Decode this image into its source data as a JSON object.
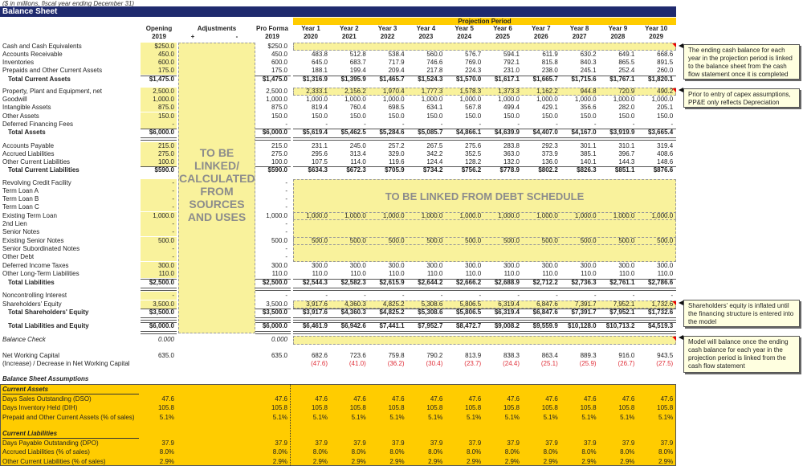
{
  "header": {
    "units_note": "($ in millions, fiscal year ending December 31)",
    "title": "Balance Sheet",
    "projection_label": "Projection Period",
    "opening_label": "Opening",
    "opening_year": "2019",
    "adjustments_label": "Adjustments",
    "plus": "+",
    "minus": "-",
    "proforma_label": "Pro Forma",
    "proforma_year": "2019",
    "years": [
      {
        "label": "Year 1",
        "year": "2020"
      },
      {
        "label": "Year 2",
        "year": "2021"
      },
      {
        "label": "Year 3",
        "year": "2022"
      },
      {
        "label": "Year 4",
        "year": "2023"
      },
      {
        "label": "Year 5",
        "year": "2024"
      },
      {
        "label": "Year 6",
        "year": "2025"
      },
      {
        "label": "Year 7",
        "year": "2026"
      },
      {
        "label": "Year 8",
        "year": "2027"
      },
      {
        "label": "Year 9",
        "year": "2028"
      },
      {
        "label": "Year 10",
        "year": "2029"
      }
    ]
  },
  "adjustments_text": [
    "TO BE",
    "LINKED/",
    "CALCULATED",
    "FROM",
    "SOURCES",
    "AND USES"
  ],
  "debt_schedule_text": "TO BE LINKED FROM DEBT SCHEDULE",
  "rows": [
    {
      "label": "Cash and Cash Equivalents",
      "opening": "$250.0",
      "proforma": "$250.0",
      "years": [
        "",
        "",
        "",
        "",
        "",
        "",
        "",
        "",
        "",
        ""
      ]
    },
    {
      "label": "Accounts Receivable",
      "opening": "450.0",
      "proforma": "450.0",
      "years": [
        "483.8",
        "512.8",
        "538.4",
        "560.0",
        "576.7",
        "594.1",
        "611.9",
        "630.2",
        "649.1",
        "668.6"
      ]
    },
    {
      "label": "Inventories",
      "opening": "600.0",
      "proforma": "600.0",
      "years": [
        "645.0",
        "683.7",
        "717.9",
        "746.6",
        "769.0",
        "792.1",
        "815.8",
        "840.3",
        "865.5",
        "891.5"
      ]
    },
    {
      "label": "Prepaids and Other Current Assets",
      "opening": "175.0",
      "proforma": "175.0",
      "years": [
        "188.1",
        "199.4",
        "209.4",
        "217.8",
        "224.3",
        "231.0",
        "238.0",
        "245.1",
        "252.4",
        "260.0"
      ]
    },
    {
      "label": "Total Current Assets",
      "type": "total",
      "opening": "$1,475.0",
      "proforma": "$1,475.0",
      "years": [
        "$1,316.9",
        "$1,395.9",
        "$1,465.7",
        "$1,524.3",
        "$1,570.0",
        "$1,617.1",
        "$1,665.7",
        "$1,715.6",
        "$1,767.1",
        "$1,820.1"
      ]
    },
    {
      "label": "Property, Plant and Equipment, net",
      "opening": "2,500.0",
      "proforma": "2,500.0",
      "years": [
        "2,333.1",
        "2,156.2",
        "1,970.4",
        "1,777.3",
        "1,578.3",
        "1,373.3",
        "1,162.2",
        "944.8",
        "720.9",
        "490.2"
      ]
    },
    {
      "label": "Goodwill",
      "opening": "1,000.0",
      "proforma": "1,000.0",
      "years": [
        "1,000.0",
        "1,000.0",
        "1,000.0",
        "1,000.0",
        "1,000.0",
        "1,000.0",
        "1,000.0",
        "1,000.0",
        "1,000.0",
        "1,000.0"
      ]
    },
    {
      "label": "Intangible Assets",
      "opening": "875.0",
      "proforma": "875.0",
      "years": [
        "819.4",
        "760.4",
        "698.5",
        "634.1",
        "567.8",
        "499.4",
        "429.1",
        "356.6",
        "282.0",
        "205.1"
      ]
    },
    {
      "label": "Other Assets",
      "opening": "150.0",
      "proforma": "150.0",
      "years": [
        "150.0",
        "150.0",
        "150.0",
        "150.0",
        "150.0",
        "150.0",
        "150.0",
        "150.0",
        "150.0",
        "150.0"
      ]
    },
    {
      "label": "Deferred Financing Fees",
      "opening": "-",
      "proforma": "-",
      "years": [
        "-",
        "-",
        "-",
        "-",
        "-",
        "-",
        "-",
        "-",
        "-",
        "-"
      ]
    },
    {
      "label": "Total Assets",
      "type": "total",
      "opening": "$6,000.0",
      "proforma": "$6,000.0",
      "years": [
        "$5,619.4",
        "$5,462.5",
        "$5,284.6",
        "$5,085.7",
        "$4,866.1",
        "$4,639.9",
        "$4,407.0",
        "$4,167.0",
        "$3,919.9",
        "$3,665.4"
      ]
    },
    {
      "label": "Accounts Payable",
      "opening": "215.0",
      "proforma": "215.0",
      "years": [
        "231.1",
        "245.0",
        "257.2",
        "267.5",
        "275.6",
        "283.8",
        "292.3",
        "301.1",
        "310.1",
        "319.4"
      ]
    },
    {
      "label": "Accrued Liabilities",
      "opening": "275.0",
      "proforma": "275.0",
      "years": [
        "295.6",
        "313.4",
        "329.0",
        "342.2",
        "352.5",
        "363.0",
        "373.9",
        "385.1",
        "396.7",
        "408.6"
      ]
    },
    {
      "label": "Other Current Liabilities",
      "opening": "100.0",
      "proforma": "100.0",
      "years": [
        "107.5",
        "114.0",
        "119.6",
        "124.4",
        "128.2",
        "132.0",
        "136.0",
        "140.1",
        "144.3",
        "148.6"
      ]
    },
    {
      "label": "Total Current Liabilities",
      "type": "total",
      "opening": "$590.0",
      "proforma": "$590.0",
      "years": [
        "$634.3",
        "$672.3",
        "$705.9",
        "$734.2",
        "$756.2",
        "$778.9",
        "$802.2",
        "$826.3",
        "$851.1",
        "$876.6"
      ]
    },
    {
      "label": "Revolving Credit Facility",
      "opening": "-",
      "proforma": "-",
      "years": [
        "",
        "",
        "",
        "",
        "",
        "",
        "",
        "",
        "",
        ""
      ]
    },
    {
      "label": "Term Loan A",
      "opening": "-",
      "proforma": "-",
      "years": [
        "",
        "",
        "",
        "",
        "",
        "",
        "",
        "",
        "",
        ""
      ]
    },
    {
      "label": "Term Loan B",
      "opening": "-",
      "proforma": "-",
      "years": [
        "",
        "",
        "",
        "",
        "",
        "",
        "",
        "",
        "",
        ""
      ]
    },
    {
      "label": "Term Loan C",
      "opening": "-",
      "proforma": "-",
      "years": [
        "",
        "",
        "",
        "",
        "",
        "",
        "",
        "",
        "",
        ""
      ]
    },
    {
      "label": "Existing Term Loan",
      "opening": "1,000.0",
      "proforma": "1,000.0",
      "years": [
        "1,000.0",
        "1,000.0",
        "1,000.0",
        "1,000.0",
        "1,000.0",
        "1,000.0",
        "1,000.0",
        "1,000.0",
        "1,000.0",
        "1,000.0"
      ]
    },
    {
      "label": "2nd Lien",
      "opening": "-",
      "proforma": "-",
      "years": [
        "",
        "",
        "",
        "",
        "",
        "",
        "",
        "",
        "",
        ""
      ]
    },
    {
      "label": "Senior Notes",
      "opening": "-",
      "proforma": "-",
      "years": [
        "",
        "",
        "",
        "",
        "",
        "",
        "",
        "",
        "",
        ""
      ]
    },
    {
      "label": "Existing Senior Notes",
      "opening": "500.0",
      "proforma": "500.0",
      "years": [
        "500.0",
        "500.0",
        "500.0",
        "500.0",
        "500.0",
        "500.0",
        "500.0",
        "500.0",
        "500.0",
        "500.0"
      ]
    },
    {
      "label": "Senior Subordinated Notes",
      "opening": "-",
      "proforma": "-",
      "years": [
        "",
        "",
        "",
        "",
        "",
        "",
        "",
        "",
        "",
        ""
      ]
    },
    {
      "label": "Other Debt",
      "opening": "-",
      "proforma": "-",
      "years": [
        "",
        "",
        "",
        "",
        "",
        "",
        "",
        "",
        "",
        ""
      ]
    },
    {
      "label": "Deferred Income Taxes",
      "opening": "300.0",
      "proforma": "300.0",
      "years": [
        "300.0",
        "300.0",
        "300.0",
        "300.0",
        "300.0",
        "300.0",
        "300.0",
        "300.0",
        "300.0",
        "300.0"
      ]
    },
    {
      "label": "Other Long-Term Liabilities",
      "opening": "110.0",
      "proforma": "110.0",
      "years": [
        "110.0",
        "110.0",
        "110.0",
        "110.0",
        "110.0",
        "110.0",
        "110.0",
        "110.0",
        "110.0",
        "110.0"
      ]
    },
    {
      "label": "Total Liabilities",
      "type": "total",
      "opening": "$2,500.0",
      "proforma": "$2,500.0",
      "years": [
        "$2,544.3",
        "$2,582.3",
        "$2,615.9",
        "$2,644.2",
        "$2,666.2",
        "$2,688.9",
        "$2,712.2",
        "$2,736.3",
        "$2,761.1",
        "$2,786.6"
      ]
    },
    {
      "label": "Noncontrolling Interest",
      "opening": "-",
      "proforma": "-",
      "years": [
        "-",
        "-",
        "-",
        "-",
        "-",
        "-",
        "-",
        "-",
        "-",
        "-"
      ]
    },
    {
      "label": "Shareholders' Equity",
      "opening": "3,500.0",
      "proforma": "3,500.0",
      "years": [
        "3,917.6",
        "4,360.3",
        "4,825.2",
        "5,308.6",
        "5,806.5",
        "6,319.4",
        "6,847.6",
        "7,391.7",
        "7,952.1",
        "1,732.6"
      ]
    },
    {
      "label": "Total Shareholders' Equity",
      "type": "total",
      "opening": "$3,500.0",
      "proforma": "$3,500.0",
      "years": [
        "$3,917.6",
        "$4,360.3",
        "$4,825.2",
        "$5,308.6",
        "$5,806.5",
        "$6,319.4",
        "$6,847.6",
        "$7,391.7",
        "$7,952.1",
        "$1,732.6"
      ]
    },
    {
      "label": "Total Liabilities and Equity",
      "type": "total",
      "opening": "$6,000.0",
      "proforma": "$6,000.0",
      "years": [
        "$6,461.9",
        "$6,942.6",
        "$7,441.1",
        "$7,952.7",
        "$8,472.7",
        "$9,008.2",
        "$9,559.9",
        "$10,128.0",
        "$10,713.2",
        "$4,519.3"
      ]
    },
    {
      "label": "Balance Check",
      "type": "italic",
      "opening": "0.000",
      "proforma": "0.000",
      "years": [
        "",
        "",
        "",
        "",
        "",
        "",
        "",
        "",
        "",
        ""
      ]
    },
    {
      "label": "Net Working Capital",
      "opening": "635.0",
      "proforma": "635.0",
      "years": [
        "682.6",
        "723.6",
        "759.8",
        "790.2",
        "813.9",
        "838.3",
        "863.4",
        "889.3",
        "916.0",
        "943.5"
      ]
    },
    {
      "label": "(Increase) / Decrease in Net Working Capital",
      "type": "red",
      "opening": "",
      "proforma": "",
      "years": [
        "(47.6)",
        "(41.0)",
        "(36.2)",
        "(30.4)",
        "(23.7)",
        "(24.4)",
        "(25.1)",
        "(25.9)",
        "(26.7)",
        "(27.5)"
      ]
    }
  ],
  "assumptions": {
    "title": "Balance Sheet Assumptions",
    "sections": [
      {
        "title": "Current Assets",
        "rows": [
          {
            "label": "Days Sales Outstanding (DSO)",
            "opening": "47.6",
            "proforma": "47.6",
            "years": [
              "47.6",
              "47.6",
              "47.6",
              "47.6",
              "47.6",
              "47.6",
              "47.6",
              "47.6",
              "47.6",
              "47.6"
            ]
          },
          {
            "label": "Days Inventory Held (DIH)",
            "opening": "105.8",
            "proforma": "105.8",
            "years": [
              "105.8",
              "105.8",
              "105.8",
              "105.8",
              "105.8",
              "105.8",
              "105.8",
              "105.8",
              "105.8",
              "105.8"
            ]
          },
          {
            "label": "Prepaid and Other Current Assets (% of sales)",
            "opening": "5.1%",
            "proforma": "5.1%",
            "years": [
              "5.1%",
              "5.1%",
              "5.1%",
              "5.1%",
              "5.1%",
              "5.1%",
              "5.1%",
              "5.1%",
              "5.1%",
              "5.1%"
            ]
          }
        ]
      },
      {
        "title": "Current Liabilities",
        "rows": [
          {
            "label": "Days Payable Outstanding (DPO)",
            "opening": "37.9",
            "proforma": "37.9",
            "years": [
              "37.9",
              "37.9",
              "37.9",
              "37.9",
              "37.9",
              "37.9",
              "37.9",
              "37.9",
              "37.9",
              "37.9"
            ]
          },
          {
            "label": "Accrued Liabilities (% of sales)",
            "opening": "8.0%",
            "proforma": "8.0%",
            "years": [
              "8.0%",
              "8.0%",
              "8.0%",
              "8.0%",
              "8.0%",
              "8.0%",
              "8.0%",
              "8.0%",
              "8.0%",
              "8.0%"
            ]
          },
          {
            "label": "Other Current Liabilities (% of sales)",
            "opening": "2.9%",
            "proforma": "2.9%",
            "years": [
              "2.9%",
              "2.9%",
              "2.9%",
              "2.9%",
              "2.9%",
              "2.9%",
              "2.9%",
              "2.9%",
              "2.9%",
              "2.9%"
            ]
          }
        ]
      }
    ]
  },
  "notes": [
    "The ending cash balance for each year in the projection period is linked to the balance sheet from the cash flow statement once it is completed",
    "Prior to entry of capex assumptions, PP&E only reflects Depreciation",
    "Shareholders' equity is inflated until the financing structure is entered into the model",
    "Model will balance once the ending cash balance for each year in the projection period is linked from the cash flow statement"
  ],
  "colors": {
    "title_bar": "#1f2a6e",
    "projection_bar": "#ffcc00",
    "input_fill": "#f9f29c",
    "negative": "#e0303a",
    "note_fill": "#ffffe0"
  }
}
